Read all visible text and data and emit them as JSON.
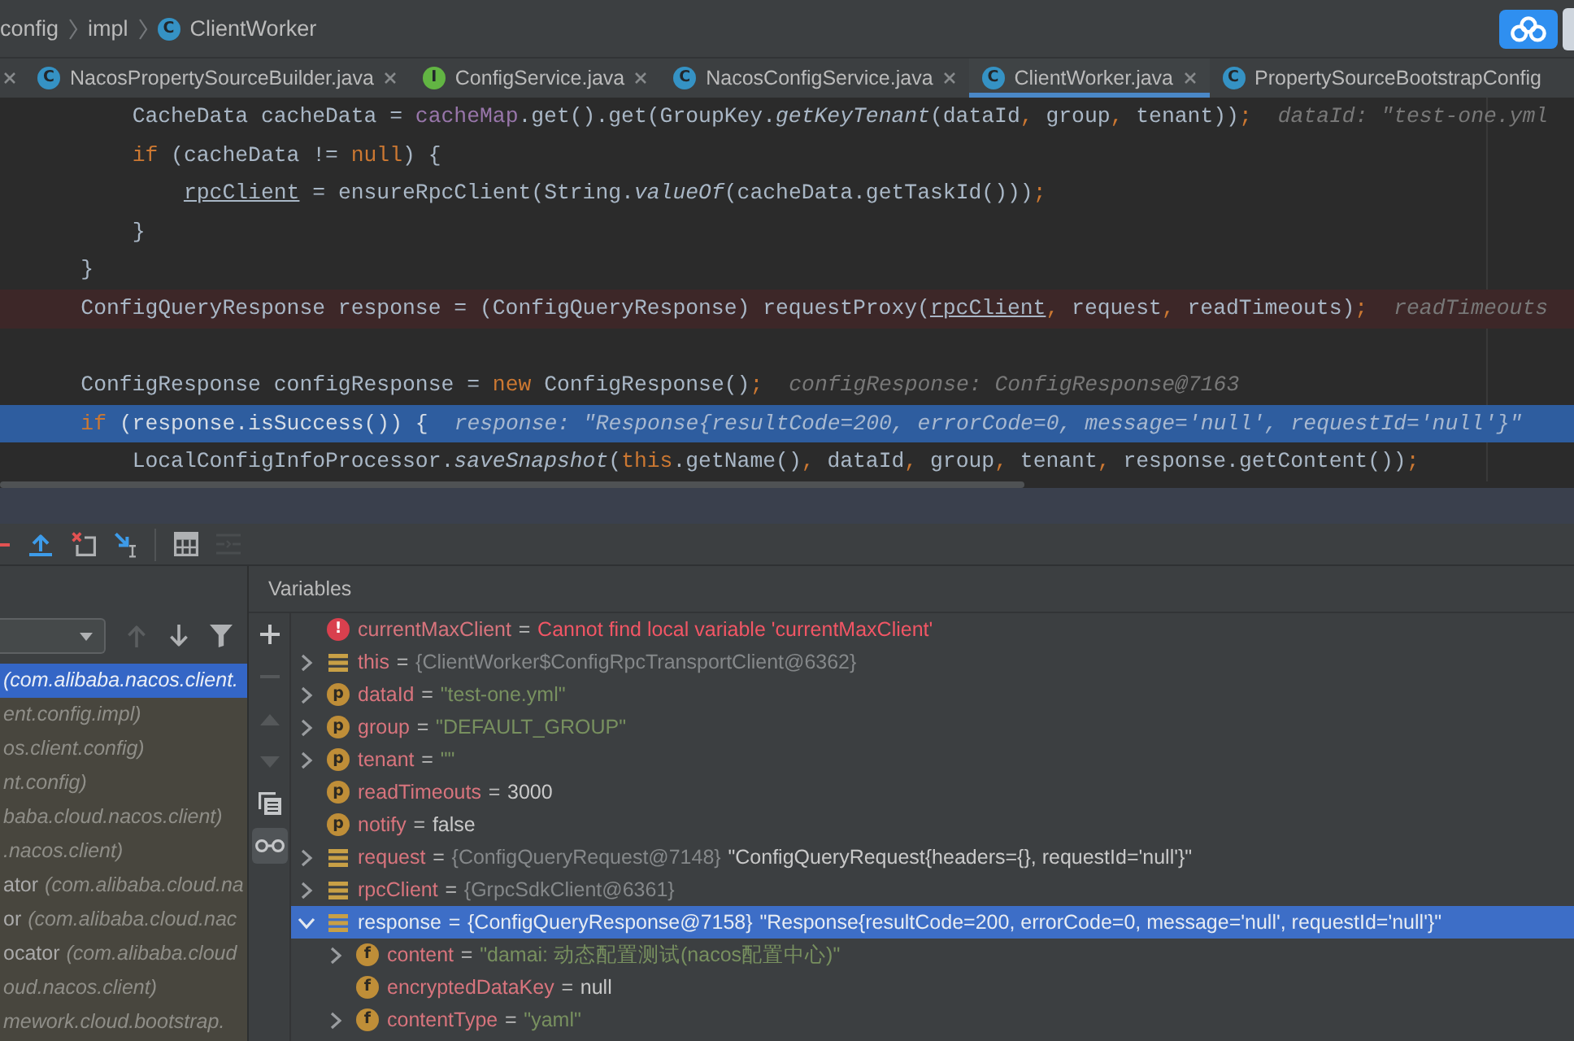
{
  "breadcrumb": [
    {
      "label": "config"
    },
    {
      "label": "impl"
    },
    {
      "label": "ClientWorker",
      "badge": {
        "kind": "class",
        "letter": "C"
      }
    }
  ],
  "tabs": [
    {
      "kind": "clipped",
      "selected": false,
      "closable": true
    },
    {
      "kind": "file",
      "badge": {
        "kind": "class",
        "letter": "C"
      },
      "label": "NacosPropertySourceBuilder.java",
      "selected": false,
      "closable": true
    },
    {
      "kind": "file",
      "badge": {
        "kind": "interface",
        "letter": "I"
      },
      "label": "ConfigService.java",
      "selected": false,
      "closable": true
    },
    {
      "kind": "file",
      "badge": {
        "kind": "class",
        "letter": "C"
      },
      "label": "NacosConfigService.java",
      "selected": false,
      "closable": true
    },
    {
      "kind": "file",
      "badge": {
        "kind": "class",
        "letter": "C"
      },
      "label": "ClientWorker.java",
      "selected": true,
      "closable": true
    },
    {
      "kind": "file",
      "badge": {
        "kind": "class",
        "letter": "C"
      },
      "label": "PropertySourceBootstrapConfig",
      "selected": false,
      "closable": false
    }
  ],
  "code_lines": [
    {
      "breakpoint": false,
      "current": false,
      "tokens": [
        {
          "kind": "plain",
          "text": "        CacheData cacheData = "
        },
        {
          "kind": "field",
          "text": "cacheMap"
        },
        {
          "kind": "plain",
          "text": ".get().get(GroupKey."
        },
        {
          "kind": "static",
          "text": "getKeyTenant"
        },
        {
          "kind": "plain",
          "text": "(dataId"
        },
        {
          "kind": "punct",
          "text": ", "
        },
        {
          "kind": "plain",
          "text": "group"
        },
        {
          "kind": "punct",
          "text": ", "
        },
        {
          "kind": "plain",
          "text": "tenant))"
        },
        {
          "kind": "punct",
          "text": ";"
        },
        {
          "kind": "hint",
          "text": "dataId: \"test-one.yml"
        }
      ]
    },
    {
      "breakpoint": false,
      "current": false,
      "tokens": [
        {
          "kind": "keyword",
          "text": "        if"
        },
        {
          "kind": "plain",
          "text": " (cacheData != "
        },
        {
          "kind": "keyword",
          "text": "null"
        },
        {
          "kind": "plain",
          "text": ") {"
        }
      ]
    },
    {
      "breakpoint": false,
      "current": false,
      "tokens": [
        {
          "kind": "reassigned",
          "text": "            rpcClient"
        },
        {
          "kind": "plain",
          "text": " = ensureRpcClient(String."
        },
        {
          "kind": "static",
          "text": "valueOf"
        },
        {
          "kind": "plain",
          "text": "(cacheData.getTaskId()))"
        },
        {
          "kind": "punct",
          "text": ";"
        }
      ]
    },
    {
      "breakpoint": false,
      "current": false,
      "tokens": [
        {
          "kind": "plain",
          "text": "        }"
        }
      ]
    },
    {
      "breakpoint": false,
      "current": false,
      "tokens": [
        {
          "kind": "plain",
          "text": "    }"
        }
      ]
    },
    {
      "breakpoint": true,
      "current": false,
      "tokens": [
        {
          "kind": "plain",
          "text": "    ConfigQueryResponse response = (ConfigQueryResponse) requestProxy("
        },
        {
          "kind": "reassigned",
          "text": "rpcClient"
        },
        {
          "kind": "punct",
          "text": ", "
        },
        {
          "kind": "plain",
          "text": "request"
        },
        {
          "kind": "punct",
          "text": ", "
        },
        {
          "kind": "plain",
          "text": "readTimeouts)"
        },
        {
          "kind": "punct",
          "text": ";"
        },
        {
          "kind": "hint",
          "text": "readTimeouts"
        }
      ]
    },
    {
      "breakpoint": false,
      "current": false
    },
    {
      "breakpoint": false,
      "current": false,
      "tokens": [
        {
          "kind": "plain",
          "text": "    ConfigResponse configResponse = "
        },
        {
          "kind": "keyword",
          "text": "new"
        },
        {
          "kind": "plain",
          "text": " ConfigResponse()"
        },
        {
          "kind": "punct",
          "text": ";"
        },
        {
          "kind": "hint",
          "text": "configResponse: ConfigResponse@7163"
        }
      ]
    },
    {
      "breakpoint": false,
      "current": true,
      "tokens": [
        {
          "kind": "keyword",
          "text": "    if"
        },
        {
          "kind": "plain",
          "text": " (response.isSuccess()) {"
        },
        {
          "kind": "hint",
          "text": "response: \"Response{resultCode=200, errorCode=0, message='null', requestId='null'}\""
        }
      ]
    },
    {
      "breakpoint": false,
      "current": false,
      "tokens": [
        {
          "kind": "plain",
          "text": "        LocalConfigInfoProcessor."
        },
        {
          "kind": "static",
          "text": "saveSnapshot"
        },
        {
          "kind": "plain",
          "text": "("
        },
        {
          "kind": "keyword",
          "text": "this"
        },
        {
          "kind": "plain",
          "text": ".getName()"
        },
        {
          "kind": "punct",
          "text": ", "
        },
        {
          "kind": "plain",
          "text": "dataId"
        },
        {
          "kind": "punct",
          "text": ", "
        },
        {
          "kind": "plain",
          "text": "group"
        },
        {
          "kind": "punct",
          "text": ", "
        },
        {
          "kind": "plain",
          "text": "tenant"
        },
        {
          "kind": "punct",
          "text": ", "
        },
        {
          "kind": "plain",
          "text": "response.getContent())"
        },
        {
          "kind": "punct",
          "text": ";"
        }
      ]
    }
  ],
  "debug_toolbar": [
    {
      "kind": "clipped",
      "disabled": false
    },
    {
      "kind": "step_out",
      "disabled": false
    },
    {
      "kind": "drop_frame",
      "disabled": false
    },
    {
      "kind": "run_to_cursor",
      "disabled": false
    },
    {
      "kind": "evaluate",
      "disabled": false
    },
    {
      "kind": "layout",
      "disabled": true
    }
  ],
  "frames_panel": {
    "controls": [
      {
        "kind": "up",
        "disabled": true
      },
      {
        "kind": "down",
        "disabled": false
      },
      {
        "kind": "filter",
        "disabled": false
      }
    ],
    "frames": [
      {
        "package": "(com.alibaba.nacos.client.",
        "selected": true
      },
      {
        "package": "ent.config.impl)",
        "selected": false
      },
      {
        "package": "os.client.config)",
        "selected": false
      },
      {
        "package": "nt.config)",
        "selected": false
      },
      {
        "package": "baba.cloud.nacos.client)",
        "selected": false
      },
      {
        "package": ".nacos.client)",
        "selected": false
      },
      {
        "name": "ator",
        "package": "(com.alibaba.cloud.na",
        "selected": false
      },
      {
        "name": "or",
        "package": "(com.alibaba.cloud.nac",
        "selected": false
      },
      {
        "name": "ocator",
        "package": "(com.alibaba.cloud",
        "selected": false
      },
      {
        "package": "oud.nacos.client)",
        "selected": false
      },
      {
        "package": "mework.cloud.bootstrap.",
        "selected": false
      }
    ]
  },
  "variables_panel": {
    "title": "Variables",
    "tools": [
      {
        "kind": "add",
        "disabled": false,
        "on": false
      },
      {
        "kind": "remove",
        "disabled": true,
        "on": false
      },
      {
        "kind": "up",
        "disabled": true,
        "on": false
      },
      {
        "kind": "down",
        "disabled": true,
        "on": false
      },
      {
        "kind": "copy",
        "disabled": false,
        "on": false
      },
      {
        "kind": "watches",
        "disabled": false,
        "on": true
      }
    ],
    "tree": [
      {
        "kind": "error",
        "badge": "!",
        "name": "currentMaxClient",
        "op": "=",
        "value": {
          "kind": "error",
          "text": "Cannot find local variable 'currentMaxClient'"
        },
        "expandable": false,
        "selected": false
      },
      {
        "kind": "object",
        "name": "this",
        "op": "=",
        "ref": "{ClientWorker$ConfigRpcTransportClient@6362}",
        "expandable": true,
        "expanded": false,
        "selected": false
      },
      {
        "kind": "param",
        "badge": "p",
        "name": "dataId",
        "op": "=",
        "value": {
          "kind": "string",
          "text": "\"test-one.yml\""
        },
        "expandable": true,
        "expanded": false,
        "selected": false
      },
      {
        "kind": "param",
        "badge": "p",
        "name": "group",
        "op": "=",
        "value": {
          "kind": "string",
          "text": "\"DEFAULT_GROUP\""
        },
        "expandable": true,
        "expanded": false,
        "selected": false
      },
      {
        "kind": "param",
        "badge": "p",
        "name": "tenant",
        "op": "=",
        "value": {
          "kind": "string",
          "text": "\"\""
        },
        "expandable": true,
        "expanded": false,
        "selected": false
      },
      {
        "kind": "param",
        "badge": "p",
        "name": "readTimeouts",
        "op": "=",
        "value": {
          "kind": "plain",
          "text": "3000"
        },
        "expandable": false,
        "selected": false
      },
      {
        "kind": "param",
        "badge": "p",
        "name": "notify",
        "op": "=",
        "value": {
          "kind": "plain",
          "text": "false"
        },
        "expandable": false,
        "selected": false
      },
      {
        "kind": "object",
        "name": "request",
        "op": "=",
        "ref": "{ConfigQueryRequest@7148}",
        "value": {
          "kind": "plain",
          "text": "\"ConfigQueryRequest{headers={}, requestId='null'}\""
        },
        "expandable": true,
        "expanded": false,
        "selected": false
      },
      {
        "kind": "object",
        "name": "rpcClient",
        "op": "=",
        "ref": "{GrpcSdkClient@6361}",
        "expandable": true,
        "expanded": false,
        "selected": false
      },
      {
        "kind": "object",
        "name": "response",
        "op": "=",
        "ref": "{ConfigQueryResponse@7158}",
        "value": {
          "kind": "plain",
          "text": "\"Response{resultCode=200, errorCode=0, message='null', requestId='null'}\""
        },
        "expandable": true,
        "expanded": true,
        "selected": true,
        "children": [
          {
            "kind": "field",
            "badge": "f",
            "name": "content",
            "op": "=",
            "value": {
              "kind": "string",
              "text": "\"damai: 动态配置测试(nacos配置中心)\""
            },
            "expandable": true,
            "expanded": false,
            "selected": false
          },
          {
            "kind": "field",
            "badge": "f",
            "name": "encryptedDataKey",
            "op": "=",
            "value": {
              "kind": "plain",
              "text": "null"
            },
            "expandable": false,
            "selected": false
          },
          {
            "kind": "field",
            "badge": "f",
            "name": "contentType",
            "op": "=",
            "value": {
              "kind": "string",
              "text": "\"yaml\""
            },
            "expandable": true,
            "expanded": false,
            "selected": false
          }
        ]
      }
    ]
  }
}
